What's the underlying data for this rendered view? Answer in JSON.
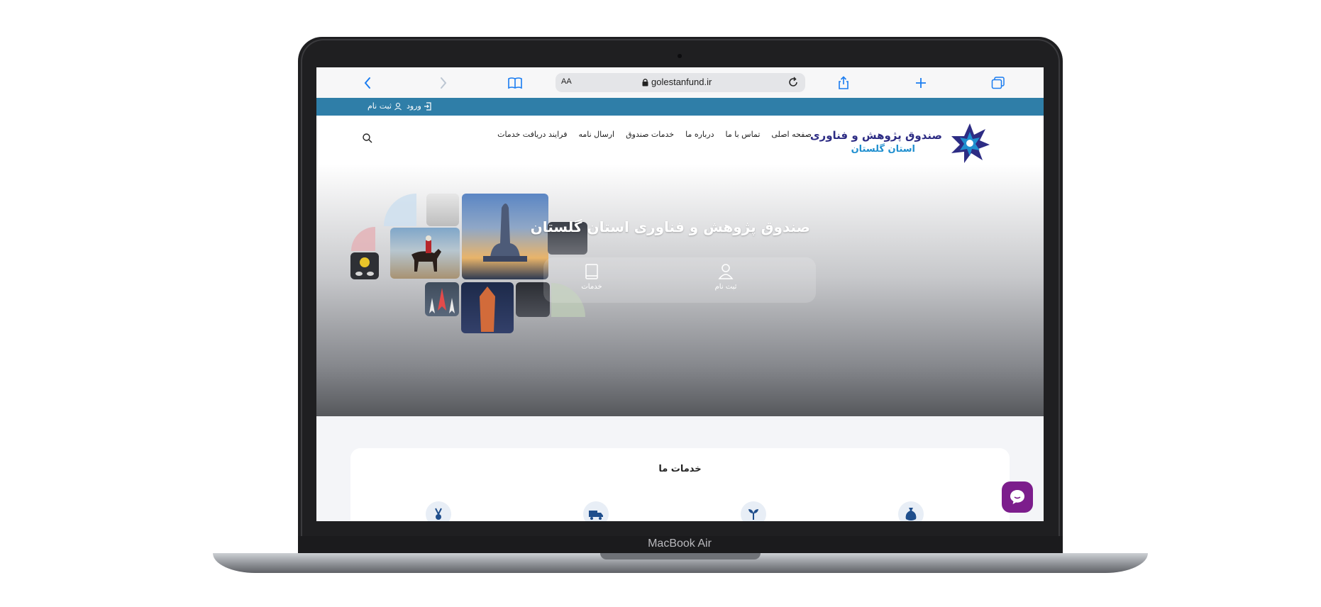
{
  "device": {
    "brand_label": "MacBook Air"
  },
  "browser": {
    "text_size_label": "AA",
    "url": "golestanfund.ir",
    "icons": [
      "back-chevron-icon",
      "forward-chevron-icon",
      "bookmarks-book-icon",
      "lock-icon",
      "reload-icon",
      "share-icon",
      "new-tab-plus-icon",
      "tabs-overview-icon"
    ]
  },
  "topbar": {
    "login_label": "ورود",
    "register_label": "ثبت نام",
    "color": "#2f7ea8"
  },
  "header": {
    "logo_title": "صندوق پژوهش و فناوری",
    "logo_subtitle": "استان گلستان",
    "nav": [
      {
        "label": "صفحه اصلی"
      },
      {
        "label": "تماس با ما"
      },
      {
        "label": "درباره ما"
      },
      {
        "label": "خدمات صندوق"
      },
      {
        "label": "ارسال نامه"
      },
      {
        "label": "فرایند دریافت خدمات"
      }
    ]
  },
  "hero": {
    "title": "صندوق پژوهش و فناوری استان گلستان",
    "buttons": [
      {
        "label": "ثبت نام",
        "icon": "user-icon"
      },
      {
        "label": "خدمات",
        "icon": "book-icon"
      }
    ]
  },
  "services": {
    "title": "خدمات ما",
    "icons": [
      "money-bag-icon",
      "plant-growth-icon",
      "truck-icon",
      "award-medal-icon"
    ]
  },
  "chat": {
    "icon": "chat-bubble-icon",
    "color": "#7c1d8c"
  }
}
